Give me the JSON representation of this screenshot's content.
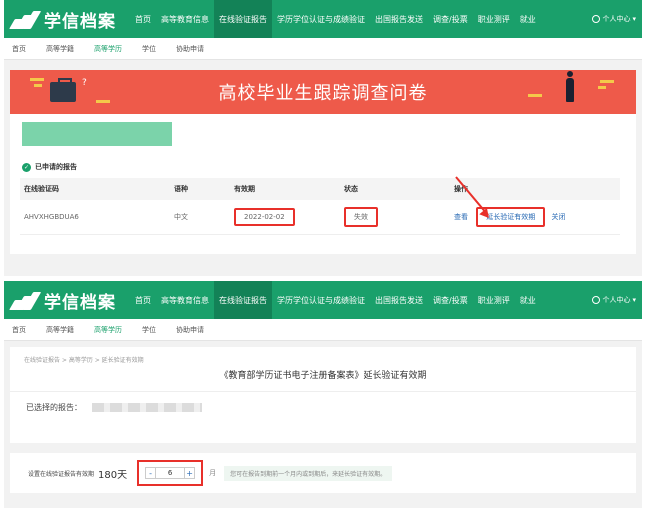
{
  "brand": {
    "name": "学信档案"
  },
  "nav": {
    "items": [
      "首页",
      "高等教育信息",
      "在线验证报告",
      "学历学位认证与成绩验证",
      "出国报告发送",
      "调查/投票",
      "职业测评",
      "就业"
    ],
    "active_index": 2,
    "user": "个人中心"
  },
  "subnav": {
    "items": [
      "首页",
      "高等学籍",
      "高等学历",
      "学位",
      "协助申请"
    ],
    "active_index": 2
  },
  "banner": {
    "title": "高校毕业生跟踪调查问卷"
  },
  "reports": {
    "section_title": "已申请的报告",
    "columns": [
      "在线验证码",
      "语种",
      "有效期",
      "状态",
      "操作"
    ],
    "row": {
      "code": "AHVXHGBDUA6",
      "language": "中文",
      "valid_until": "2022-02-02",
      "status": "失效",
      "action_view": "查看",
      "action_extend": "延长验证有效期",
      "action_close": "关闭"
    }
  },
  "extend_page": {
    "breadcrumb": "在线验证报告 > 高等学历 > 延长验证有效期",
    "title": "《教育部学历证书电子注册备案表》延长验证有效期",
    "selected_label": "已选择的报告：",
    "valid_label": "设置在线验证报告有效期",
    "valid_days": "180天",
    "stepper_minus": "-",
    "stepper_value": "6",
    "stepper_plus": "+",
    "unit": "月",
    "hint": "您可在报告到期前一个月内或到期后，来延长验证有效期。"
  },
  "colors": {
    "brand_green": "#1aa06b",
    "banner_red": "#ee5a4a",
    "highlight_red": "#e8302a",
    "link_blue": "#2a6bb5"
  }
}
